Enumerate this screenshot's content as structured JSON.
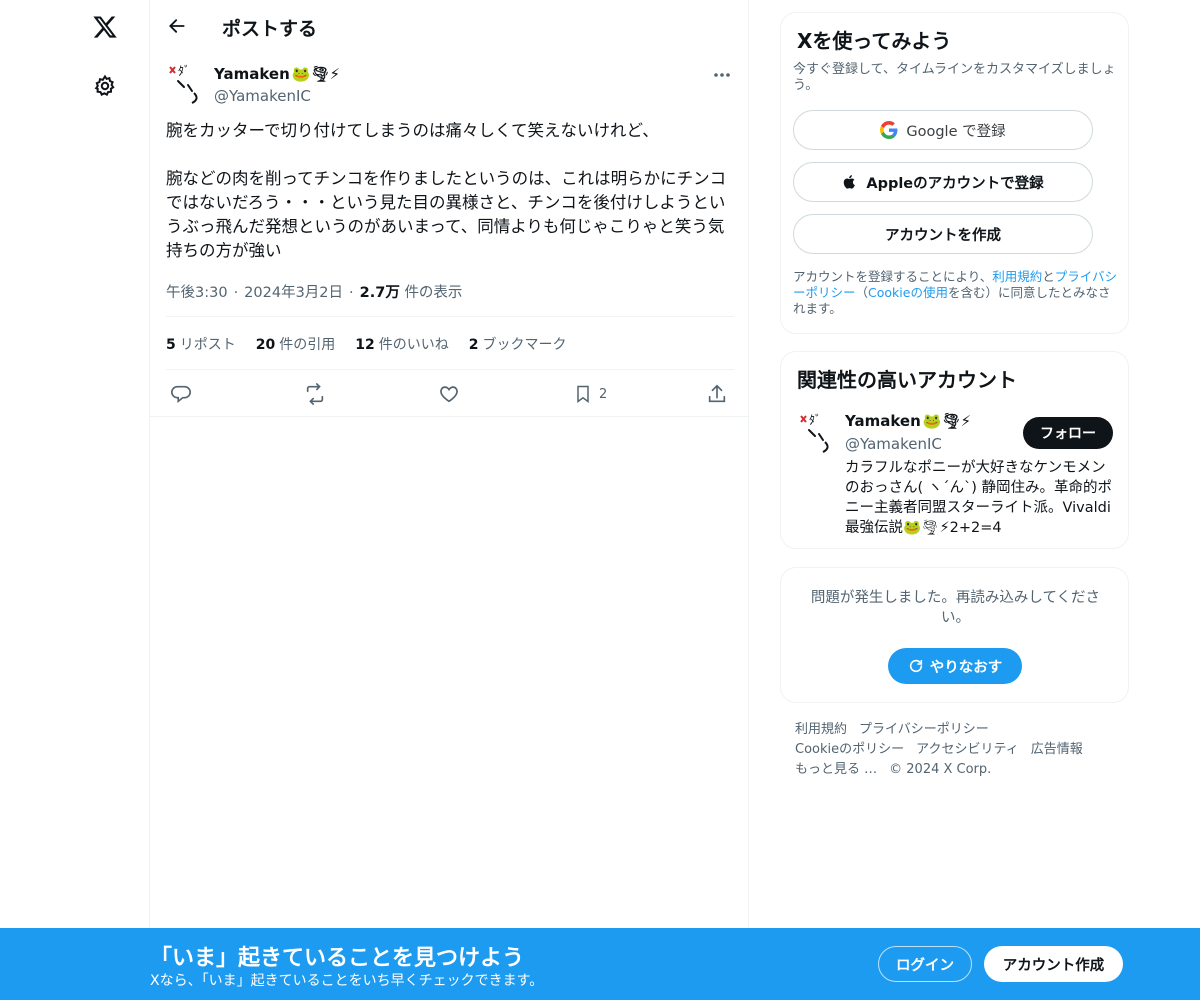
{
  "nav": {
    "logo_icon": "x-logo-icon",
    "settings_icon": "gear-icon"
  },
  "header": {
    "title": "ポストする"
  },
  "post": {
    "author_name": "Yamaken",
    "author_emoji": "🐸🌪⚡",
    "author_handle": "@YamakenIC",
    "text": "腕をカッターで切り付けてしまうのは痛々しくて笑えないけれど、\n\n腕などの肉を削ってチンコを作りましたというのは、これは明らかにチンコではないだろう・・・という見た目の異様さと、チンコを後付けしようというぶっ飛んだ発想というのがあいまって、同情よりも何じゃこりゃと笑う気持ちの方が強い",
    "time": "午後3:30",
    "dot": "·",
    "date": "2024年3月2日",
    "views_count": "2.7万",
    "views_label": "件の表示",
    "stats": [
      {
        "count": "5",
        "label": "リポスト"
      },
      {
        "count": "20",
        "label": "件の引用"
      },
      {
        "count": "12",
        "label": "件のいいね"
      },
      {
        "count": "2",
        "label": "ブックマーク"
      }
    ],
    "bookmark_count": "2"
  },
  "signup_card": {
    "title": "Xを使ってみよう",
    "subtitle": "今すぐ登録して、タイムラインをカスタマイズしましょう。",
    "google_label": "Google で登録",
    "apple_label": "Appleのアカウントで登録",
    "create_label": "アカウントを作成",
    "terms_1": "アカウントを登録することにより、",
    "terms_link1": "利用規約",
    "terms_2": "と",
    "terms_link2": "プライバシーポリシー",
    "terms_3": "（",
    "terms_link3": "Cookieの使用",
    "terms_4": "を含む）に同意したとみなされます。"
  },
  "related": {
    "title": "関連性の高いアカウント",
    "name": "Yamaken",
    "emoji": "🐸🌪⚡",
    "handle": "@YamakenIC",
    "follow_label": "フォロー",
    "bio": "カラフルなポニーが大好きなケンモメンのおっさん( ヽ´ん`) 静岡住み。革命的ポニー主義者同盟スターライト派。Vivaldi最強伝説🐸🌪⚡2+2=4"
  },
  "error_card": {
    "text": "問題が発生しました。再読み込みしてください。",
    "retry_label": "やりなおす"
  },
  "footer": {
    "links": [
      "利用規約",
      "プライバシーポリシー",
      "Cookieのポリシー",
      "アクセシビリティ",
      "広告情報",
      "もっと見る …",
      "© 2024 X Corp."
    ]
  },
  "banner": {
    "title": "「いま」起きていることを見つけよう",
    "subtitle": "Xなら、「いま」起きていることをいち早くチェックできます。",
    "login_label": "ログイン",
    "signup_label": "アカウント作成"
  },
  "colors": {
    "accent": "#1d9bf0",
    "text": "#0f1419",
    "secondary": "#536471",
    "border": "#eff3f4"
  }
}
